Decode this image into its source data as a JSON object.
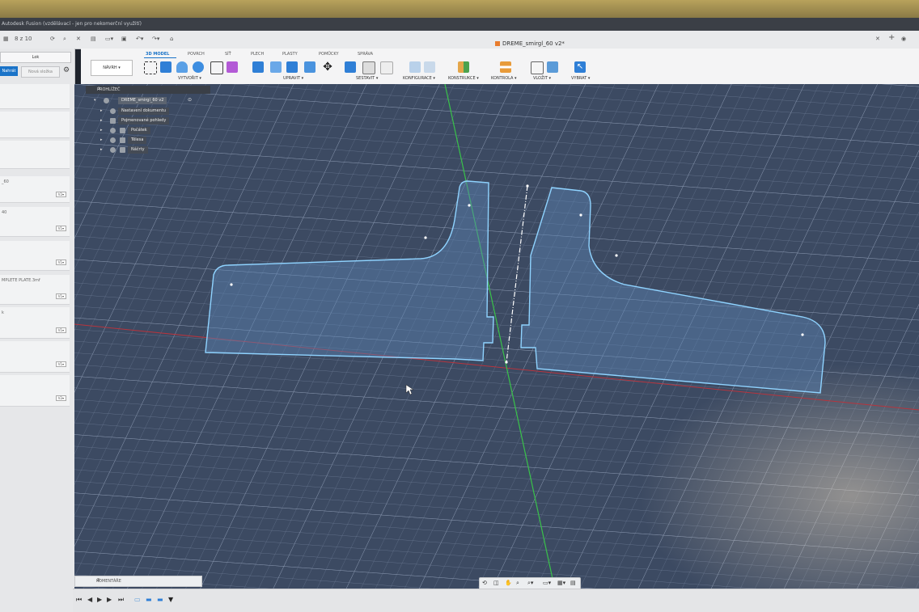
{
  "window": {
    "title": "Autodesk Fusion (vzdělávací - jen pro nekomerční využití)",
    "counter": "8 z 10"
  },
  "document": {
    "title": "DREME_smirgl_60 v2*"
  },
  "ribbon": {
    "workspace": "NÁVRH",
    "tabs": [
      "3D MODEL",
      "POVRCH",
      "SÍŤ",
      "PLECH",
      "PLASTY",
      "POMŮCKY",
      "SPRÁVA"
    ],
    "active_tab": "3D MODEL",
    "groups": [
      "VYTVOŘIT",
      "UPRAVIT",
      "SESTAVIT",
      "KONFIGURACE",
      "KONSTRUKCE",
      "KONTROLA",
      "VLOŽIT",
      "VYBRAT"
    ]
  },
  "left_panel": {
    "btn_top": "Lok",
    "btn_primary": "Nahrát",
    "btn_secondary": "Nová složka",
    "cards": [
      {
        "label": "",
        "version": ""
      },
      {
        "label": "",
        "version": ""
      },
      {
        "label": "",
        "version": ""
      },
      {
        "label": "_60",
        "version": "V2"
      },
      {
        "label": "40",
        "version": "V1"
      },
      {
        "label": "",
        "version": "V1"
      },
      {
        "label": "MPLETE PLATE.3mf",
        "version": "V1"
      },
      {
        "label": "k",
        "version": "V1"
      },
      {
        "label": "",
        "version": "V1"
      },
      {
        "label": "",
        "version": "V2"
      }
    ]
  },
  "browser": {
    "header": "PROHLÍŽEČ",
    "root": "DREME_smirgl_60 v2",
    "items": [
      "Nastavení dokumentu",
      "Pojmenované pohledy",
      "Počátek",
      "Tělesa",
      "Náčrty"
    ]
  },
  "comments": {
    "label": "KOMENTÁŘE"
  },
  "colors": {
    "accent": "#1a73c8",
    "grid_bg": "#3d4b63",
    "sketch_line": "#8fd3ff",
    "sketch_fill": "#5b86b5",
    "axis_green": "#39c24a",
    "axis_red": "#b7343d"
  },
  "icons": {
    "navbar": [
      "orbit-icon",
      "look-at-icon",
      "pan-icon",
      "zoom-icon",
      "fit-icon",
      "display-settings-icon",
      "grid-icon",
      "viewports-icon"
    ],
    "timeline": [
      "start-icon",
      "prev-icon",
      "play-icon",
      "next-icon",
      "end-icon"
    ]
  }
}
